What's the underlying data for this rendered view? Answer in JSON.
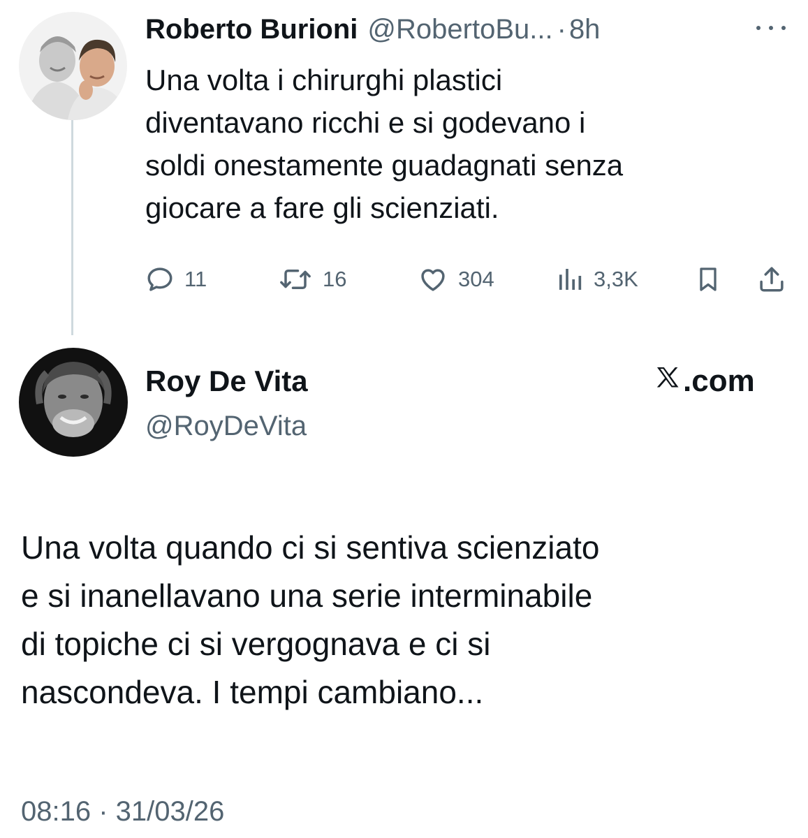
{
  "tweet": {
    "author_name": "Roberto Burioni",
    "author_handle": "@RobertoBu...",
    "separator": "·",
    "time_ago": "8h",
    "text_lines": [
      "Una volta i chirurghi plastici",
      "diventavano ricchi e si godevano i",
      "soldi onestamente guadagnati senza",
      "giocare a fare gli scienziati."
    ],
    "actions": {
      "replies": "11",
      "retweets": "16",
      "likes": "304",
      "views": "3,3K"
    },
    "icons": [
      "more-icon",
      "reply-icon",
      "retweet-icon",
      "like-icon",
      "views-icon",
      "bookmark-icon",
      "share-icon"
    ]
  },
  "embedded_tweet": {
    "author_name": "Roy De Vita",
    "author_handle": "@RoyDeVita",
    "brand": ".com",
    "brand_icon": "x-logo-icon",
    "text_lines": [
      "Una volta quando ci si sentiva scienziato",
      "e si inanellavano una serie interminabile",
      "di topiche ci si vergognava e ci si",
      "nascondeva. I tempi cambiano..."
    ],
    "timestamp": "08:16 · 31/03/26"
  },
  "colors": {
    "text_primary": "#0f1419",
    "text_secondary": "#536471",
    "thread_line": "#cfd9de",
    "background": "#ffffff"
  }
}
